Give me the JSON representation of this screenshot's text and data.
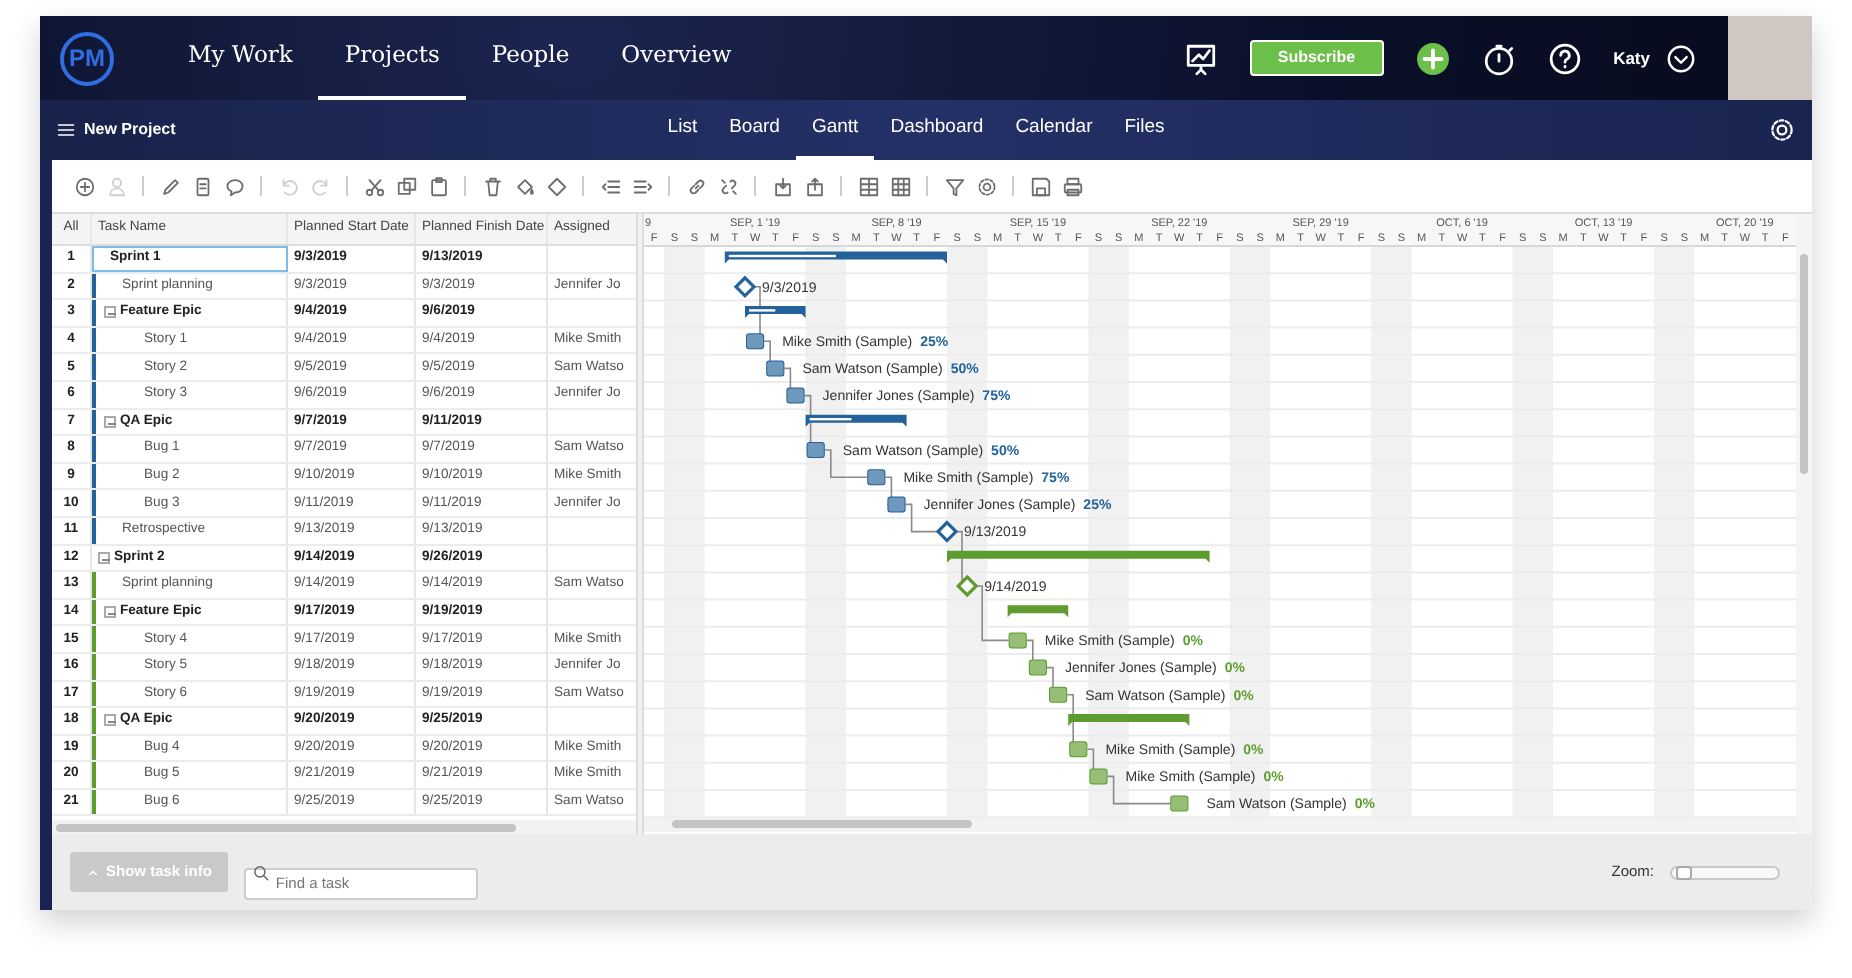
{
  "top_nav": {
    "logo": "PM",
    "items": [
      {
        "label": "My Work",
        "selected": false
      },
      {
        "label": "Projects",
        "selected": true
      },
      {
        "label": "People",
        "selected": false
      },
      {
        "label": "Overview",
        "selected": false
      }
    ],
    "subscribe": "Subscribe",
    "user": "Katy"
  },
  "project_bar": {
    "title": "New Project",
    "tabs": [
      {
        "label": "List",
        "selected": false
      },
      {
        "label": "Board",
        "selected": false
      },
      {
        "label": "Gantt",
        "selected": true
      },
      {
        "label": "Dashboard",
        "selected": false
      },
      {
        "label": "Calendar",
        "selected": false
      },
      {
        "label": "Files",
        "selected": false
      }
    ]
  },
  "toolbar_groups": [
    {
      "buttons": [
        {
          "disabled": false
        },
        {
          "disabled": true
        }
      ]
    },
    {
      "buttons": [
        {
          "disabled": false
        },
        {
          "disabled": false
        },
        {
          "disabled": false
        }
      ]
    },
    {
      "buttons": [
        {
          "disabled": true
        },
        {
          "disabled": true
        }
      ]
    },
    {
      "buttons": [
        {
          "disabled": false
        },
        {
          "disabled": false
        },
        {
          "disabled": false
        }
      ]
    },
    {
      "buttons": [
        {
          "disabled": false
        },
        {
          "disabled": false
        },
        {
          "disabled": false
        }
      ]
    },
    {
      "buttons": [
        {
          "disabled": false
        },
        {
          "disabled": false
        }
      ]
    },
    {
      "buttons": [
        {
          "disabled": false
        },
        {
          "disabled": false
        }
      ]
    },
    {
      "buttons": [
        {
          "disabled": false
        },
        {
          "disabled": false
        }
      ]
    },
    {
      "buttons": [
        {
          "disabled": false
        },
        {
          "disabled": false
        }
      ]
    },
    {
      "buttons": [
        {
          "disabled": false
        },
        {
          "disabled": false
        }
      ]
    },
    {
      "buttons": [
        {
          "disabled": false
        },
        {
          "disabled": false
        }
      ]
    }
  ],
  "table": {
    "columns": [
      "All",
      "Task Name",
      "Planned Start Date",
      "Planned Finish Date",
      "Assigned"
    ],
    "tasks": [
      {
        "num": "1",
        "name": "Sprint 1",
        "start": "9/3/2019",
        "finish": "9/13/2019",
        "kind": "summary",
        "level": 0.5,
        "color": "#23629a",
        "selected": true,
        "children": [
          {
            "num": "2",
            "name": "Sprint planning",
            "start": "9/3/2019",
            "finish": "9/3/2019",
            "assigned": "Jennifer Jo",
            "kind": "milestone",
            "bar_label": "9/3/2019",
            "selected": false
          },
          {
            "num": "3",
            "name": "Feature Epic",
            "start": "9/4/2019",
            "finish": "9/6/2019",
            "kind": "summary",
            "level": 0.5,
            "expanded": true,
            "selected": false,
            "children": [
              {
                "num": "4",
                "name": "Story 1",
                "start": "9/4/2019",
                "finish": "9/4/2019",
                "assigned": "Mike Smith",
                "kind": "task",
                "bar_label": "Mike Smith (Sample)",
                "percent": "25%",
                "selected": false
              },
              {
                "num": "5",
                "name": "Story 2",
                "start": "9/5/2019",
                "finish": "9/5/2019",
                "assigned": "Sam Watso",
                "kind": "task",
                "bar_label": "Sam Watson (Sample)",
                "percent": "50%",
                "selected": false
              },
              {
                "num": "6",
                "name": "Story 3",
                "start": "9/6/2019",
                "finish": "9/6/2019",
                "assigned": "Jennifer Jo",
                "kind": "task",
                "bar_label": "Jennifer Jones (Sample)",
                "percent": "75%",
                "selected": false
              }
            ]
          },
          {
            "num": "7",
            "name": "QA Epic",
            "start": "9/7/2019",
            "finish": "9/11/2019",
            "kind": "summary",
            "level": 0.45,
            "expanded": true,
            "selected": false,
            "children": [
              {
                "num": "8",
                "name": "Bug 1",
                "start": "9/7/2019",
                "finish": "9/7/2019",
                "assigned": "Sam Watso",
                "kind": "task",
                "bar_label": "Sam Watson (Sample)",
                "percent": "50%",
                "selected": false
              },
              {
                "num": "9",
                "name": "Bug 2",
                "start": "9/10/2019",
                "finish": "9/10/2019",
                "assigned": "Mike Smith",
                "kind": "task",
                "bar_label": "Mike Smith (Sample)",
                "percent": "75%",
                "selected": false
              },
              {
                "num": "10",
                "name": "Bug 3",
                "start": "9/11/2019",
                "finish": "9/11/2019",
                "assigned": "Jennifer Jo",
                "kind": "task",
                "bar_label": "Jennifer Jones (Sample)",
                "percent": "25%",
                "selected": false
              }
            ]
          },
          {
            "num": "11",
            "name": "Retrospective",
            "start": "9/13/2019",
            "finish": "9/13/2019",
            "kind": "milestone",
            "bar_label": "9/13/2019",
            "selected": false
          }
        ]
      },
      {
        "num": "12",
        "name": "Sprint 2",
        "start": "9/14/2019",
        "finish": "9/26/2019",
        "kind": "summary",
        "expanded": true,
        "color": "#5f9c2f",
        "selected": false,
        "children": [
          {
            "num": "13",
            "name": "Sprint planning",
            "start": "9/14/2019",
            "finish": "9/14/2019",
            "assigned": "Sam Watso",
            "kind": "milestone",
            "bar_label": "9/14/2019",
            "selected": false
          },
          {
            "num": "14",
            "name": "Feature Epic",
            "start": "9/17/2019",
            "finish": "9/19/2019",
            "kind": "summary",
            "expanded": true,
            "selected": false,
            "children": [
              {
                "num": "15",
                "name": "Story 4",
                "start": "9/17/2019",
                "finish": "9/17/2019",
                "assigned": "Mike Smith",
                "kind": "task",
                "bar_label": "Mike Smith (Sample)",
                "percent": "0%",
                "selected": false
              },
              {
                "num": "16",
                "name": "Story 5",
                "start": "9/18/2019",
                "finish": "9/18/2019",
                "assigned": "Jennifer Jo",
                "kind": "task",
                "bar_label": "Jennifer Jones (Sample)",
                "percent": "0%",
                "selected": false
              },
              {
                "num": "17",
                "name": "Story 6",
                "start": "9/19/2019",
                "finish": "9/19/2019",
                "assigned": "Sam Watso",
                "kind": "task",
                "bar_label": "Sam Watson (Sample)",
                "percent": "0%",
                "selected": false
              }
            ]
          },
          {
            "num": "18",
            "name": "QA Epic",
            "start": "9/20/2019",
            "finish": "9/25/2019",
            "kind": "summary",
            "expanded": true,
            "selected": false,
            "children": [
              {
                "num": "19",
                "name": "Bug 4",
                "start": "9/20/2019",
                "finish": "9/20/2019",
                "assigned": "Mike Smith",
                "kind": "task",
                "bar_label": "Mike Smith (Sample)",
                "percent": "0%",
                "selected": false
              },
              {
                "num": "20",
                "name": "Bug 5",
                "start": "9/21/2019",
                "finish": "9/21/2019",
                "assigned": "Mike Smith",
                "kind": "task",
                "bar_label": "Mike Smith (Sample)",
                "percent": "0%",
                "selected": false
              },
              {
                "num": "21",
                "name": "Bug 6",
                "start": "9/25/2019",
                "finish": "9/25/2019",
                "assigned": "Sam Watso",
                "kind": "task",
                "bar_label": "Sam Watson (Sample)",
                "percent": "0%",
                "selected": false
              }
            ]
          }
        ]
      }
    ]
  },
  "timeline": {
    "weeks": [
      "9",
      "SEP, 1 '19",
      "SEP, 8 '19",
      "SEP, 15 '19",
      "SEP, 22 '19",
      "SEP, 29 '19",
      "OCT, 6 '19",
      "OCT, 13 '19",
      "OCT, 20 '19"
    ],
    "days": [
      "F",
      "S",
      "S",
      "M",
      "T",
      "W",
      "T",
      "F",
      "S",
      "S",
      "M",
      "T",
      "W",
      "T",
      "F",
      "S",
      "S",
      "M",
      "T",
      "W",
      "T",
      "F",
      "S",
      "S",
      "M",
      "T",
      "W",
      "T",
      "F",
      "S",
      "S",
      "M",
      "T",
      "W",
      "T",
      "F",
      "S",
      "S",
      "M",
      "T",
      "W",
      "T",
      "F",
      "S",
      "S",
      "M",
      "T",
      "W",
      "T",
      "F",
      "S",
      "S",
      "M",
      "T",
      "W",
      "T",
      "F"
    ]
  },
  "footer": {
    "show_task_info": {
      "label": "Show task info",
      "disabled": true
    },
    "search": {
      "placeholder": "Find a task"
    },
    "zoom": {
      "label": "Zoom:",
      "level": 0.05
    }
  }
}
